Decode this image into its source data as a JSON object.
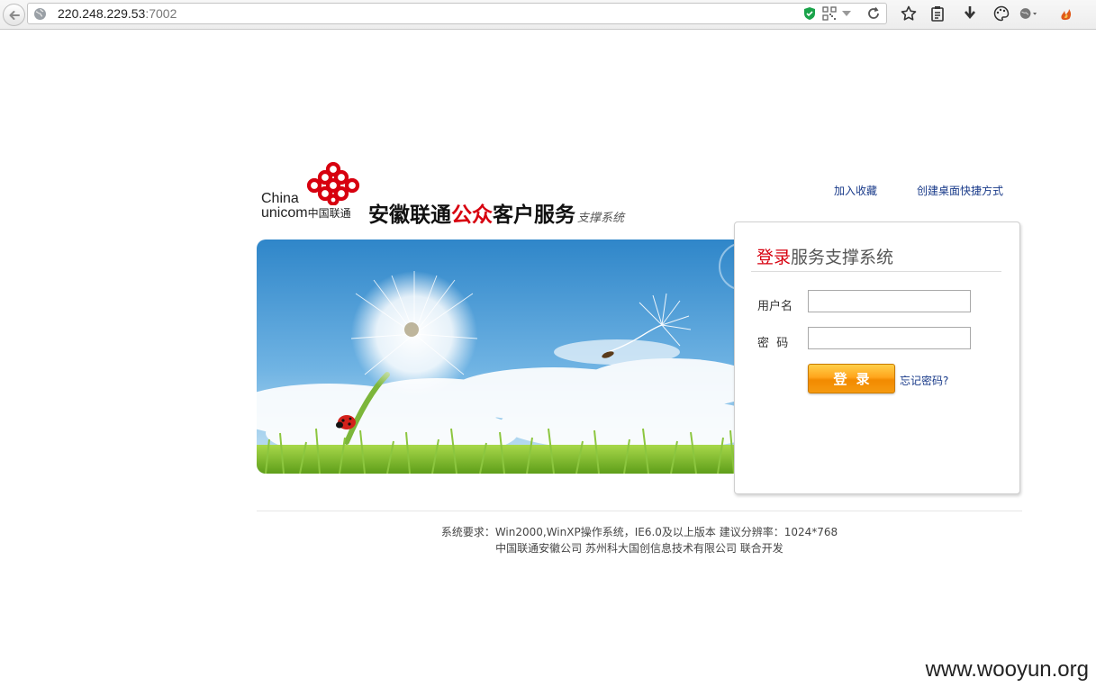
{
  "browser": {
    "url_host": "220.248.229.53",
    "url_port": ":7002"
  },
  "header": {
    "logo_china": "China",
    "logo_unicom": "unicom",
    "logo_cn": "中国联通",
    "title_part1": "安徽联通",
    "title_accent": "公众",
    "title_part2": "客户服务",
    "title_sub": "支撑系统",
    "link_favorite": "加入收藏",
    "link_shortcut": "创建桌面快捷方式"
  },
  "login": {
    "title_red": "登录",
    "title_rest": "服务支撑系统",
    "username_label": "用户名",
    "password_label": "密  码",
    "username_value": "",
    "password_value": "",
    "submit_label": "登录",
    "forgot_label": "忘记密码?"
  },
  "footer": {
    "line1": "系统要求：Win2000,WinXP操作系统，IE6.0及以上版本 建议分辨率：1024*768",
    "line2": "中国联通安徽公司 苏州科大国创信息技术有限公司 联合开发"
  },
  "watermark": "www.wooyun.org",
  "colors": {
    "accent_red": "#d7000f",
    "link_blue": "#1a3b8a",
    "button_orange": "#f59a10"
  }
}
